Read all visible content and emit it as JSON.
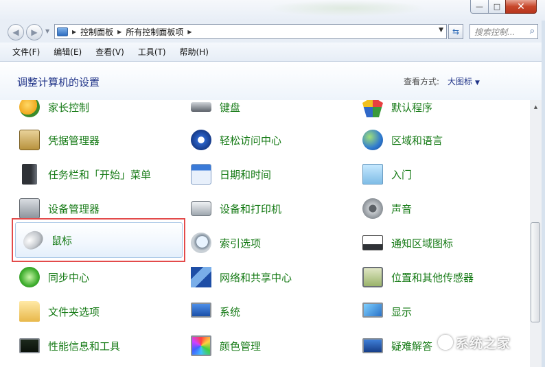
{
  "window": {
    "minimize_glyph": "—",
    "maximize_glyph": "□",
    "close_glyph": "✕"
  },
  "address": {
    "segments": [
      "控制面板",
      "所有控制面板项"
    ],
    "search_placeholder": "搜索控制...",
    "search_icon": "search-icon"
  },
  "menu": [
    "文件(F)",
    "编辑(E)",
    "查看(V)",
    "工具(T)",
    "帮助(H)"
  ],
  "header": {
    "title": "调整计算机的设置",
    "view_label": "查看方式:",
    "view_value": "大图标"
  },
  "items": [
    {
      "label": "家长控制",
      "icon": "parental-controls-icon",
      "col": 0,
      "row": 0
    },
    {
      "label": "键盘",
      "icon": "keyboard-icon",
      "col": 1,
      "row": 0
    },
    {
      "label": "默认程序",
      "icon": "default-programs-icon",
      "col": 2,
      "row": 0
    },
    {
      "label": "凭据管理器",
      "icon": "credential-manager-icon",
      "col": 0,
      "row": 1
    },
    {
      "label": "轻松访问中心",
      "icon": "ease-of-access-icon",
      "col": 1,
      "row": 1
    },
    {
      "label": "区域和语言",
      "icon": "region-language-icon",
      "col": 2,
      "row": 1
    },
    {
      "label": "任务栏和「开始」菜单",
      "icon": "taskbar-start-menu-icon",
      "col": 0,
      "row": 2
    },
    {
      "label": "日期和时间",
      "icon": "date-time-icon",
      "col": 1,
      "row": 2
    },
    {
      "label": "入门",
      "icon": "getting-started-icon",
      "col": 2,
      "row": 2
    },
    {
      "label": "设备管理器",
      "icon": "device-manager-icon",
      "col": 0,
      "row": 3
    },
    {
      "label": "设备和打印机",
      "icon": "devices-printers-icon",
      "col": 1,
      "row": 3
    },
    {
      "label": "声音",
      "icon": "sound-icon",
      "col": 2,
      "row": 3
    },
    {
      "label": "鼠标",
      "icon": "mouse-icon",
      "col": 0,
      "row": 4,
      "selected": true
    },
    {
      "label": "索引选项",
      "icon": "indexing-options-icon",
      "col": 1,
      "row": 4
    },
    {
      "label": "通知区域图标",
      "icon": "notification-area-icon",
      "col": 2,
      "row": 4
    },
    {
      "label": "同步中心",
      "icon": "sync-center-icon",
      "col": 0,
      "row": 5
    },
    {
      "label": "网络和共享中心",
      "icon": "network-sharing-icon",
      "col": 1,
      "row": 5
    },
    {
      "label": "位置和其他传感器",
      "icon": "location-sensors-icon",
      "col": 2,
      "row": 5
    },
    {
      "label": "文件夹选项",
      "icon": "folder-options-icon",
      "col": 0,
      "row": 6
    },
    {
      "label": "系统",
      "icon": "system-icon",
      "col": 1,
      "row": 6
    },
    {
      "label": "显示",
      "icon": "display-icon",
      "col": 2,
      "row": 6
    },
    {
      "label": "性能信息和工具",
      "icon": "performance-tools-icon",
      "col": 0,
      "row": 7
    },
    {
      "label": "颜色管理",
      "icon": "color-management-icon",
      "col": 1,
      "row": 7
    },
    {
      "label": "疑难解答",
      "icon": "troubleshooting-icon",
      "col": 2,
      "row": 7
    }
  ],
  "watermark": "系统之家"
}
